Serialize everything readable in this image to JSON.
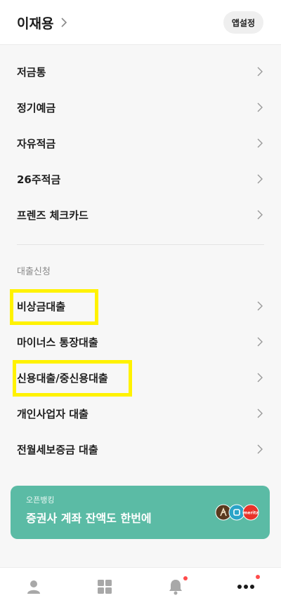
{
  "header": {
    "user_name": "이재용",
    "settings_label": "앱설정"
  },
  "menu": {
    "accounts": [
      {
        "label": "저금통"
      },
      {
        "label": "정기예금"
      },
      {
        "label": "자유적금"
      },
      {
        "label": "26주적금"
      },
      {
        "label": "프렌즈 체크카드"
      }
    ],
    "loan_section_title": "대출신청",
    "loans": [
      {
        "label": "비상금대출"
      },
      {
        "label": "마이너스 통장대출"
      },
      {
        "label": "신용대출/중신용대출"
      },
      {
        "label": "개인사업자 대출"
      },
      {
        "label": "전월세보증금 대출"
      }
    ]
  },
  "banner": {
    "subtitle": "오픈뱅킹",
    "title": "증권사 계좌 잔액도 한번에",
    "logo_text": "meritz"
  },
  "bottom_nav": {
    "items": [
      {
        "icon": "person-icon"
      },
      {
        "icon": "grid-icon"
      },
      {
        "icon": "bell-icon",
        "badge": true
      },
      {
        "icon": "more-icon",
        "badge": true
      }
    ]
  },
  "colors": {
    "highlight": "#fff200",
    "banner": "#5bbba5",
    "badge": "#ff4b4b"
  }
}
